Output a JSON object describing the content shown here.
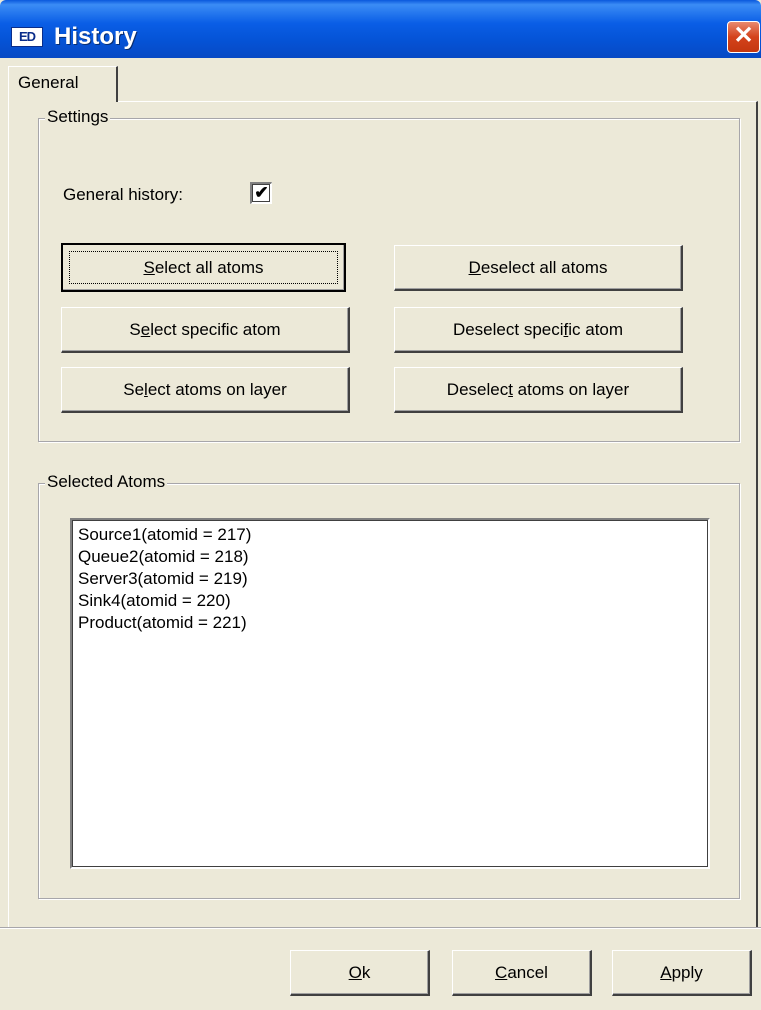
{
  "window": {
    "title": "History",
    "app_icon_text": "ED",
    "close_symbol": "✕"
  },
  "tabs": [
    {
      "label": "General"
    }
  ],
  "settings": {
    "legend": "Settings",
    "general_history_label": "General history:",
    "general_history_checked": true,
    "check_mark": "✔",
    "buttons": {
      "select_all": {
        "pre": "",
        "key": "S",
        "post": "elect all atoms"
      },
      "deselect_all": {
        "pre": "",
        "key": "D",
        "post": "eselect all atoms"
      },
      "select_specific": {
        "pre": "S",
        "key": "e",
        "post": "lect specific atom"
      },
      "deselect_specific": {
        "pre": "Deselect speci",
        "key": "f",
        "post": "ic atom"
      },
      "select_layer": {
        "pre": "Se",
        "key": "l",
        "post": "ect atoms on layer"
      },
      "deselect_layer": {
        "pre": "Deselec",
        "key": "t",
        "post": " atoms on layer"
      }
    }
  },
  "selected_atoms": {
    "legend": "Selected Atoms",
    "items": [
      "Source1(atomid = 217)",
      "Queue2(atomid = 218)",
      "Server3(atomid = 219)",
      "Sink4(atomid = 220)",
      "Product(atomid = 221)"
    ]
  },
  "footer": {
    "ok": {
      "pre": "",
      "key": "O",
      "post": "k"
    },
    "cancel": {
      "pre": "",
      "key": "C",
      "post": "ancel"
    },
    "apply": {
      "pre": "",
      "key": "A",
      "post": "pply"
    }
  }
}
